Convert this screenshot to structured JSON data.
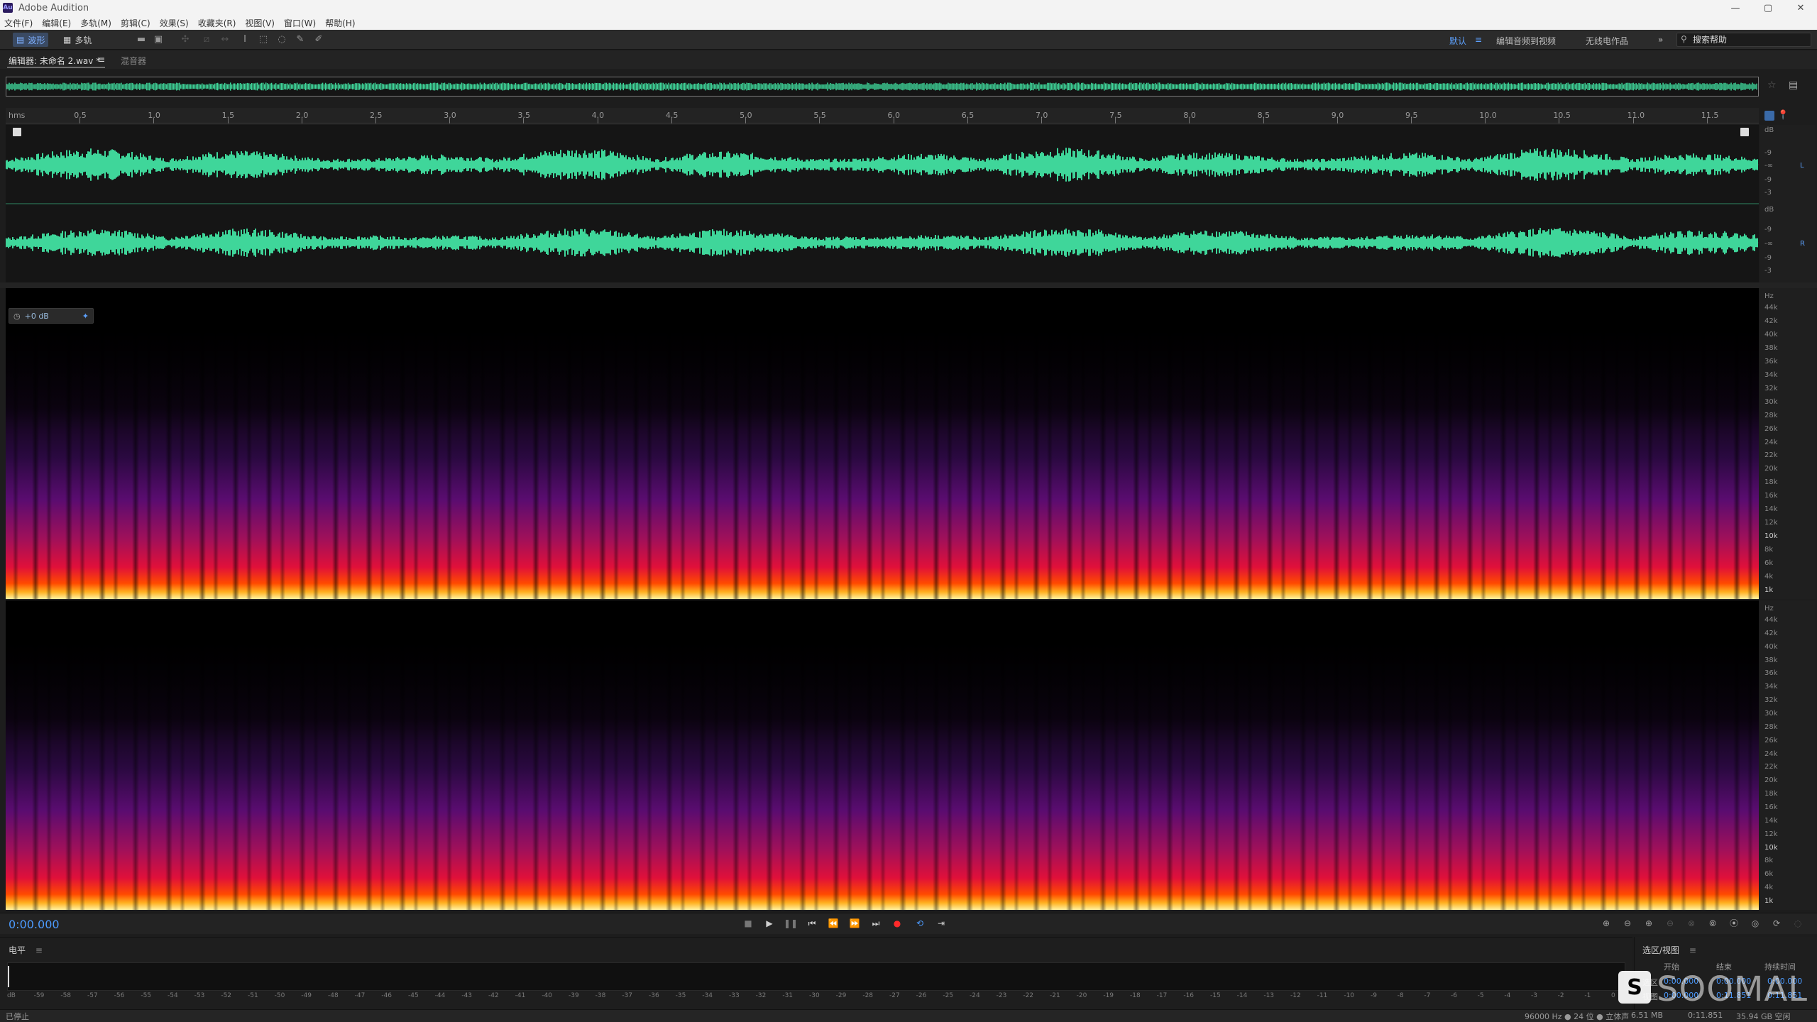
{
  "window": {
    "title": "Adobe Audition",
    "logo": "Au"
  },
  "menu": [
    "文件(F)",
    "编辑(E)",
    "多轨(M)",
    "剪辑(C)",
    "效果(S)",
    "收藏夹(R)",
    "视图(V)",
    "窗口(W)",
    "帮助(H)"
  ],
  "toolbar": {
    "waveform_label": "波形",
    "multitrack_label": "多轨",
    "workspaces": [
      "默认",
      "编辑音频到视频",
      "无线电作品"
    ],
    "more": "»",
    "search_placeholder": "搜索帮助"
  },
  "editor": {
    "tab_label": "编辑器: 未命名 2.wav *",
    "tab_menu": "≡",
    "mixer_tab": "混音器"
  },
  "ruler": {
    "start": "hms",
    "ticks": [
      "0.5",
      "1.0",
      "1.5",
      "2.0",
      "2.5",
      "3.0",
      "3.5",
      "4.0",
      "4.5",
      "5.0",
      "5.5",
      "6.0",
      "6.5",
      "7.0",
      "7.5",
      "8.0",
      "8.5",
      "9.0",
      "9.5",
      "10.0",
      "10.5",
      "11.0",
      "11.5"
    ]
  },
  "db_scale": {
    "unit": "dB",
    "ch1": [
      "-9",
      "-∞",
      "-9",
      "-3"
    ],
    "ch2": [
      "-9",
      "-∞",
      "-9",
      "-3"
    ],
    "ch1_label": "L",
    "ch2_label": "R"
  },
  "spectrogram": {
    "gain": "+0 dB",
    "unit": "Hz",
    "freq_labels": [
      "44k",
      "42k",
      "40k",
      "38k",
      "36k",
      "34k",
      "32k",
      "30k",
      "28k",
      "26k",
      "24k",
      "22k",
      "20k",
      "18k",
      "16k",
      "14k",
      "12k",
      "10k",
      "8k",
      "6k",
      "4k",
      "1k"
    ]
  },
  "transport": {
    "time": "0:00.000",
    "buttons": [
      "stop",
      "play",
      "pause",
      "to-start",
      "rewind",
      "fast-forward",
      "to-end",
      "record",
      "loop",
      "skip-selection"
    ]
  },
  "level": {
    "title": "电平",
    "menu": "≡",
    "scale": [
      "dB",
      "-59",
      "-58",
      "-57",
      "-56",
      "-55",
      "-54",
      "-53",
      "-52",
      "-51",
      "-50",
      "-49",
      "-48",
      "-47",
      "-46",
      "-45",
      "-44",
      "-43",
      "-42",
      "-41",
      "-40",
      "-39",
      "-38",
      "-37",
      "-36",
      "-35",
      "-34",
      "-33",
      "-32",
      "-31",
      "-30",
      "-29",
      "-28",
      "-27",
      "-26",
      "-25",
      "-24",
      "-23",
      "-22",
      "-21",
      "-20",
      "-19",
      "-18",
      "-17",
      "-16",
      "-15",
      "-14",
      "-13",
      "-12",
      "-11",
      "-10",
      "-9",
      "-8",
      "-7",
      "-6",
      "-5",
      "-4",
      "-3",
      "-2",
      "-1",
      "0"
    ]
  },
  "selection_view": {
    "title": "选区/视图",
    "menu": "≡",
    "headers": [
      "开始",
      "结束",
      "持续时间"
    ],
    "rows": [
      {
        "label": "选区",
        "start": "0:00.000",
        "end": "0:00.000",
        "duration": "0:00.000"
      },
      {
        "label": "视图",
        "start": "0:00.000",
        "end": "0:11.851",
        "duration": "0:11.851"
      }
    ]
  },
  "status": {
    "left": "已停止",
    "format": "96000 Hz ● 24 位 ● 立体声",
    "size": "6.51 MB",
    "duration": "0:11.851",
    "free": "35.94 GB 空闲"
  },
  "watermark": "SOOMAL",
  "colors": {
    "waveform": "#3fd69a",
    "accent": "#4c9bff",
    "record": "#ff2a2a"
  }
}
